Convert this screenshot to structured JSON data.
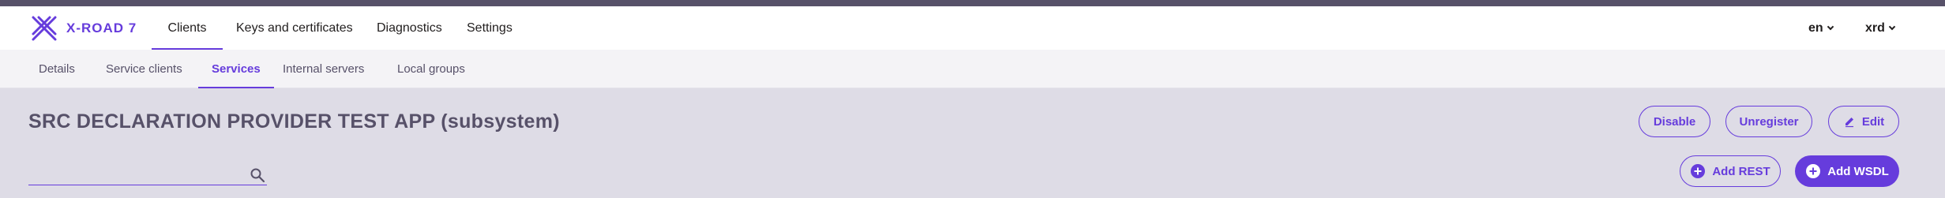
{
  "header": {
    "logo_text": "X-ROAD 7",
    "main_tabs": [
      {
        "label": "Clients",
        "active": true
      },
      {
        "label": "Keys and certificates",
        "active": false
      },
      {
        "label": "Diagnostics",
        "active": false
      },
      {
        "label": "Settings",
        "active": false
      }
    ],
    "language": "en",
    "user": "xrd"
  },
  "subnav": {
    "tabs": [
      {
        "label": "Details",
        "active": false
      },
      {
        "label": "Service clients",
        "active": false
      },
      {
        "label": "Services",
        "active": true
      },
      {
        "label": "Internal servers",
        "active": false
      },
      {
        "label": "Local groups",
        "active": false
      }
    ]
  },
  "page": {
    "title": "SRC DECLARATION PROVIDER TEST APP (subsystem)",
    "actions": {
      "disable": "Disable",
      "unregister": "Unregister",
      "edit": "Edit"
    },
    "search": {
      "value": "",
      "placeholder": ""
    },
    "add_rest": "Add REST",
    "add_wsdl": "Add WSDL"
  },
  "colors": {
    "accent": "#663cdc",
    "top_strip": "#575169",
    "page_bg": "#dedce6"
  }
}
